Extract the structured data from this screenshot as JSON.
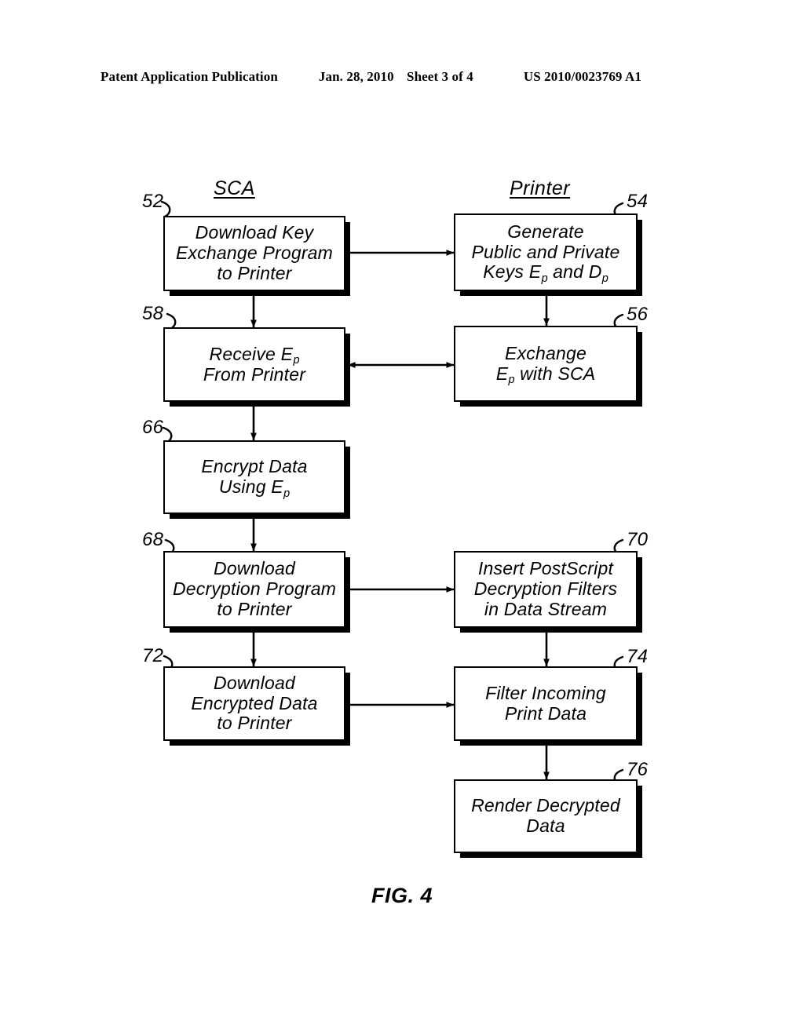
{
  "header": {
    "publication": "Patent Application Publication",
    "date": "Jan. 28, 2010",
    "sheet": "Sheet 3 of 4",
    "pub_number": "US 2010/0023769 A1"
  },
  "figure": {
    "caption": "FIG. 4",
    "columns": [
      {
        "id": "sca",
        "label": "SCA"
      },
      {
        "id": "printer",
        "label": "Printer"
      }
    ],
    "boxes": [
      {
        "ref": "52",
        "column": "sca",
        "lines": [
          "Download Key",
          "Exchange Program",
          "to Printer"
        ]
      },
      {
        "ref": "54",
        "column": "printer",
        "lines": [
          "Generate",
          "Public and Private",
          "Keys E p and D p"
        ],
        "line_parts": [
          [
            {
              "t": "Generate"
            }
          ],
          [
            {
              "t": "Public and Private"
            }
          ],
          [
            {
              "t": "Keys E"
            },
            {
              "t": "p",
              "sub": true
            },
            {
              "t": " and D"
            },
            {
              "t": "p",
              "sub": true
            }
          ]
        ]
      },
      {
        "ref": "58",
        "column": "sca",
        "lines": [
          "Receive E p",
          "From Printer"
        ],
        "line_parts": [
          [
            {
              "t": "Receive E"
            },
            {
              "t": "p",
              "sub": true
            }
          ],
          [
            {
              "t": "From Printer"
            }
          ]
        ]
      },
      {
        "ref": "56",
        "column": "printer",
        "lines": [
          "Exchange",
          "E p with SCA"
        ],
        "line_parts": [
          [
            {
              "t": "Exchange"
            }
          ],
          [
            {
              "t": "E"
            },
            {
              "t": "p",
              "sub": true
            },
            {
              "t": " with SCA"
            }
          ]
        ]
      },
      {
        "ref": "66",
        "column": "sca",
        "lines": [
          "Encrypt Data",
          "Using E p"
        ],
        "line_parts": [
          [
            {
              "t": "Encrypt Data"
            }
          ],
          [
            {
              "t": "Using E"
            },
            {
              "t": "p",
              "sub": true
            }
          ]
        ]
      },
      {
        "ref": "68",
        "column": "sca",
        "lines": [
          "Download",
          "Decryption Program",
          "to Printer"
        ]
      },
      {
        "ref": "70",
        "column": "printer",
        "lines": [
          "Insert PostScript",
          "Decryption Filters",
          "in Data Stream"
        ]
      },
      {
        "ref": "72",
        "column": "sca",
        "lines": [
          "Download",
          "Encrypted Data",
          "to Printer"
        ]
      },
      {
        "ref": "74",
        "column": "printer",
        "lines": [
          "Filter Incoming",
          "Print Data"
        ]
      },
      {
        "ref": "76",
        "column": "printer",
        "lines": [
          "Render Decrypted",
          "Data"
        ]
      }
    ],
    "connections": [
      {
        "from": "52",
        "to": "54",
        "direction": "right"
      },
      {
        "from": "52",
        "to": "58",
        "direction": "down"
      },
      {
        "from": "54",
        "to": "56",
        "direction": "down"
      },
      {
        "from": "58",
        "to": "56",
        "direction": "both"
      },
      {
        "from": "58",
        "to": "66",
        "direction": "down"
      },
      {
        "from": "66",
        "to": "68",
        "direction": "down"
      },
      {
        "from": "68",
        "to": "70",
        "direction": "right"
      },
      {
        "from": "68",
        "to": "72",
        "direction": "down"
      },
      {
        "from": "70",
        "to": "74",
        "direction": "down"
      },
      {
        "from": "72",
        "to": "74",
        "direction": "right"
      },
      {
        "from": "74",
        "to": "76",
        "direction": "down"
      }
    ]
  },
  "colors": {
    "ink": "#000000",
    "paper": "#ffffff"
  }
}
